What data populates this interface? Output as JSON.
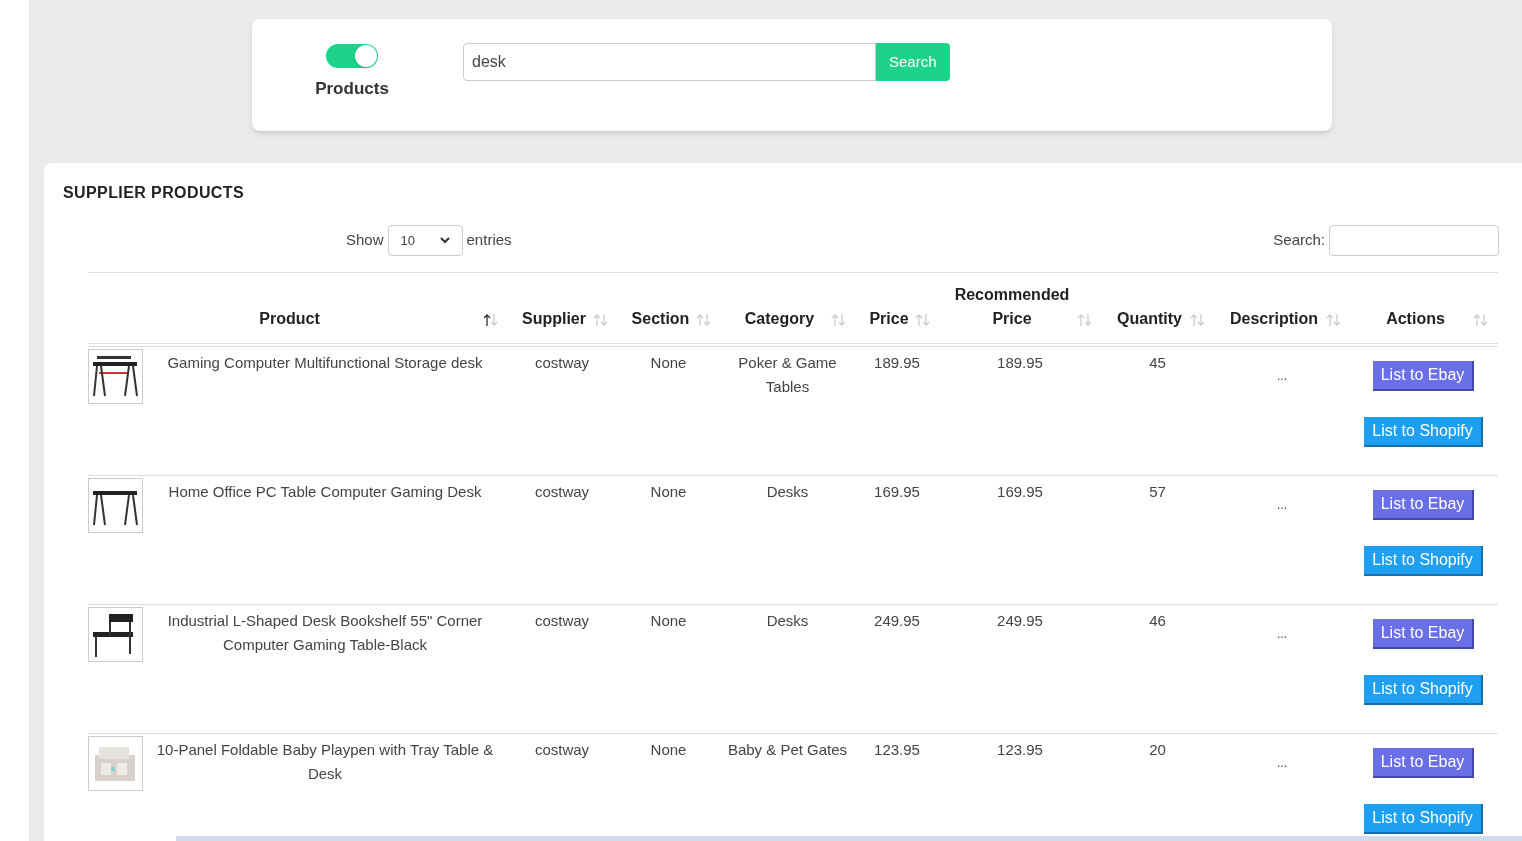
{
  "toggle": {
    "label": "Products",
    "on": true
  },
  "search_bar": {
    "value": "desk",
    "button": "Search"
  },
  "panel": {
    "title": "SUPPLIER PRODUCTS",
    "show_label": "Show",
    "page_size": "10",
    "entries_label": "entries",
    "search_label": "Search:"
  },
  "table": {
    "columns": [
      {
        "label": "Product",
        "sorted": true
      },
      {
        "label": "Supplier",
        "sorted": false
      },
      {
        "label": "Section",
        "sorted": false
      },
      {
        "label": "Category",
        "sorted": false
      },
      {
        "label": "Price",
        "sorted": false
      },
      {
        "label": "Recommended Price",
        "sorted": false
      },
      {
        "label": "Quantity",
        "sorted": false
      },
      {
        "label": "Description",
        "sorted": false
      },
      {
        "label": "Actions",
        "sorted": false
      }
    ],
    "rows": [
      {
        "product": "Gaming Computer Multifunctional Storage desk",
        "supplier": "costway",
        "section": "None",
        "category": "Poker & Game Tables",
        "price": "189.95",
        "recommended_price": "189.95",
        "quantity": "45",
        "description": "...",
        "buttons": [
          "List to Ebay",
          "List to Shopify"
        ]
      },
      {
        "product": "Home Office PC Table Computer Gaming Desk",
        "supplier": "costway",
        "section": "None",
        "category": "Desks",
        "price": "169.95",
        "recommended_price": "169.95",
        "quantity": "57",
        "description": "...",
        "buttons": [
          "List to Ebay",
          "List to Shopify"
        ]
      },
      {
        "product": "Industrial L-Shaped Desk Bookshelf 55\" Corner Computer Gaming Table-Black",
        "supplier": "costway",
        "section": "None",
        "category": "Desks",
        "price": "249.95",
        "recommended_price": "249.95",
        "quantity": "46",
        "description": "...",
        "buttons": [
          "List to Ebay",
          "List to Shopify"
        ]
      },
      {
        "product": "10-Panel Foldable Baby Playpen with Tray Table & Desk",
        "supplier": "costway",
        "section": "None",
        "category": "Baby & Pet Gates",
        "price": "123.95",
        "recommended_price": "123.95",
        "quantity": "20",
        "description": "...",
        "buttons": [
          "List to Ebay",
          "List to Shopify"
        ]
      }
    ]
  }
}
